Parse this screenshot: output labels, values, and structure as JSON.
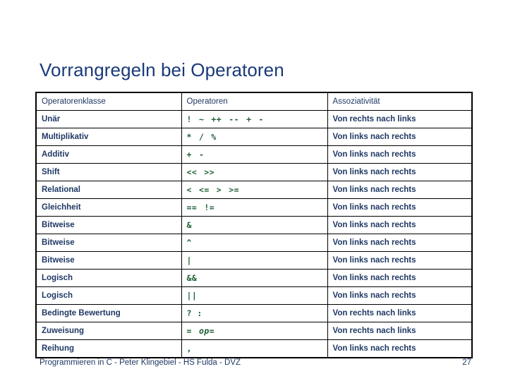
{
  "slide": {
    "title": "Vorrangregeln bei Operatoren",
    "title_color": "#1a3a7a",
    "background_color": "#ffffff"
  },
  "table": {
    "headers": {
      "col1": "Operatorenklasse",
      "col2": "Operatoren",
      "col3": "Assoziativität"
    },
    "header_text_color": "#1f3864",
    "class_text_color": "#1f3864",
    "operator_text_color": "#1e5c32",
    "border_color": "#000000",
    "rows": [
      {
        "klasse": "Unär",
        "operators": [
          "!",
          "~",
          "++",
          "--",
          "+",
          "-"
        ],
        "operators_text": "!  ~  ++  --  +  -",
        "assoziativitaet": "Von rechts nach links"
      },
      {
        "klasse": "Multiplikativ",
        "operators": [
          "*",
          "/",
          "%"
        ],
        "operators_text": "*  /  %",
        "assoziativitaet": "Von links nach rechts"
      },
      {
        "klasse": "Additiv",
        "operators": [
          "+",
          "-"
        ],
        "operators_text": "+  -",
        "assoziativitaet": "Von links nach rechts"
      },
      {
        "klasse": "Shift",
        "operators": [
          "<<",
          ">>"
        ],
        "operators_text": "<<  >>",
        "assoziativitaet": "Von links nach rechts"
      },
      {
        "klasse": "Relational",
        "operators": [
          "<",
          "<=",
          ">",
          ">="
        ],
        "operators_text": "<  <=  >  >=",
        "assoziativitaet": "Von links nach rechts"
      },
      {
        "klasse": "Gleichheit",
        "operators": [
          "==",
          "!="
        ],
        "operators_text": "==  !=",
        "assoziativitaet": "Von links nach rechts"
      },
      {
        "klasse": "Bitweise",
        "operators": [
          "&"
        ],
        "operators_text": "&",
        "assoziativitaet": "Von links nach rechts"
      },
      {
        "klasse": "Bitweise",
        "operators": [
          "^"
        ],
        "operators_text": "^",
        "assoziativitaet": "Von links nach rechts"
      },
      {
        "klasse": "Bitweise",
        "operators": [
          "|"
        ],
        "operators_text": "|",
        "assoziativitaet": "Von links nach rechts"
      },
      {
        "klasse": "Logisch",
        "operators": [
          "&&"
        ],
        "operators_text": "&&",
        "assoziativitaet": "Von links nach rechts"
      },
      {
        "klasse": "Logisch",
        "operators": [
          "||"
        ],
        "operators_text": "||",
        "assoziativitaet": "Von links nach rechts"
      },
      {
        "klasse": "Bedingte Bewertung",
        "operators": [
          "? :"
        ],
        "operators_text": "? :",
        "assoziativitaet": "Von rechts nach links"
      },
      {
        "klasse": "Zuweisung",
        "operators": [
          "=",
          "op="
        ],
        "operators_text": "=   op=",
        "operators_parts": [
          {
            "text": "=",
            "italic": false
          },
          {
            "text": "op",
            "italic": true
          },
          {
            "text": "=",
            "italic": false
          }
        ],
        "assoziativitaet": "Von rechts nach links"
      },
      {
        "klasse": "Reihung",
        "operators": [
          ","
        ],
        "operators_text": ",",
        "assoziativitaet": "Von links nach rechts"
      }
    ]
  },
  "footer": {
    "text": "Programmieren in C - Peter Klingebiel - HS Fulda - DVZ",
    "page_number": "27"
  }
}
